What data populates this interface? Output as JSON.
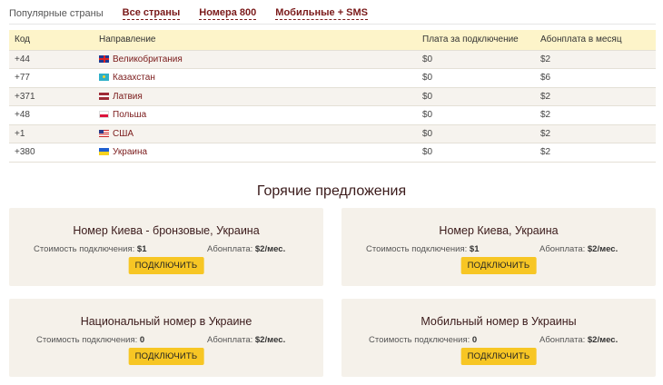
{
  "tabs": [
    {
      "label": "Популярные страны"
    },
    {
      "label": "Все страны"
    },
    {
      "label": "Номера 800"
    },
    {
      "label": "Мобильные + SMS"
    }
  ],
  "table": {
    "headers": {
      "code": "Код",
      "direction": "Направление",
      "connection_fee": "Плата за подключение",
      "monthly_fee": "Абонплата в месяц"
    },
    "rows": [
      {
        "code": "+44",
        "country": "Великобритания",
        "flag_icon": "uk-flag-icon",
        "connection_fee": "$0",
        "monthly_fee": "$2"
      },
      {
        "code": "+77",
        "country": "Казахстан",
        "flag_icon": "kazakhstan-flag-icon",
        "connection_fee": "$0",
        "monthly_fee": "$6"
      },
      {
        "code": "+371",
        "country": "Латвия",
        "flag_icon": "latvia-flag-icon",
        "connection_fee": "$0",
        "monthly_fee": "$2"
      },
      {
        "code": "+48",
        "country": "Польша",
        "flag_icon": "poland-flag-icon",
        "connection_fee": "$0",
        "monthly_fee": "$2"
      },
      {
        "code": "+1",
        "country": "США",
        "flag_icon": "usa-flag-icon",
        "connection_fee": "$0",
        "monthly_fee": "$2"
      },
      {
        "code": "+380",
        "country": "Украина",
        "flag_icon": "ukraine-flag-icon",
        "connection_fee": "$0",
        "monthly_fee": "$2"
      }
    ]
  },
  "hot_offers": {
    "title": "Горячие предложения",
    "cost_label": "Стоимость подключения:",
    "monthly_label": "Абонплата:",
    "button_label": "ПОДКЛЮЧИТЬ",
    "cards": [
      {
        "title": "Номер Киева - бронзовые, Украина",
        "cost": "$1",
        "monthly": "$2/мес."
      },
      {
        "title": "Номер Киева, Украина",
        "cost": "$1",
        "monthly": "$2/мес."
      },
      {
        "title": "Национальный номер в Украине",
        "cost": "0",
        "monthly": "$2/мес."
      },
      {
        "title": "Мобильный номер в Украины",
        "cost": "0",
        "monthly": "$2/мес."
      }
    ]
  },
  "colors": {
    "accent_link": "#7a1a1a",
    "table_header_bg": "#fdf4c9",
    "row_stripe": "#f6f3ee",
    "card_bg": "#f5f1ea",
    "button_bg": "#f7c624"
  }
}
